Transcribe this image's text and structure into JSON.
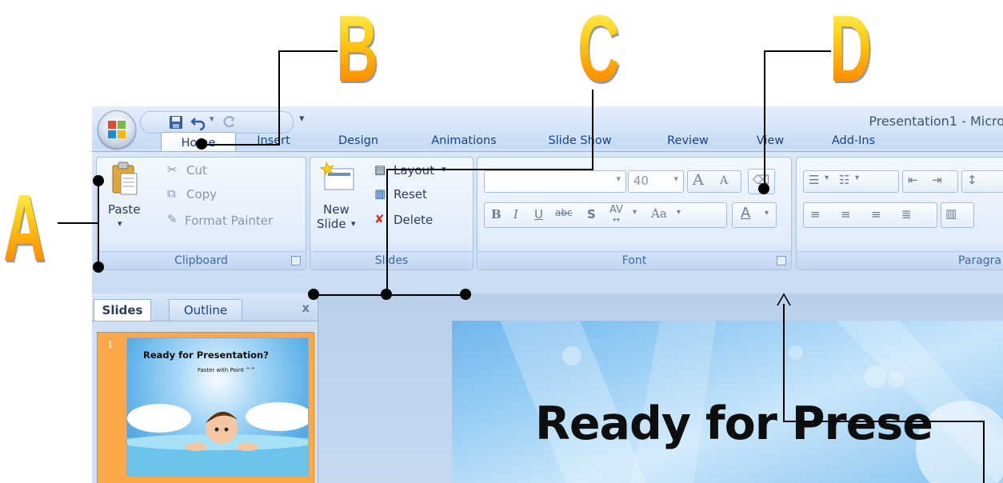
{
  "callouts": {
    "a": "A",
    "b": "B",
    "c": "C",
    "d": "D"
  },
  "window": {
    "title": "Presentation1 - Micro"
  },
  "tabs": [
    {
      "label": "Home"
    },
    {
      "label": "Insert"
    },
    {
      "label": "Design"
    },
    {
      "label": "Animations"
    },
    {
      "label": "Slide Show"
    },
    {
      "label": "Review"
    },
    {
      "label": "View"
    },
    {
      "label": "Add-Ins"
    }
  ],
  "clipboard": {
    "paste": "Paste",
    "cut": "Cut",
    "copy": "Copy",
    "format_painter": "Format Painter",
    "label": "Clipboard"
  },
  "slides_group": {
    "new_slide_line1": "New",
    "new_slide_line2": "Slide",
    "layout": "Layout",
    "reset": "Reset",
    "delete": "Delete",
    "label": "Slides"
  },
  "font_group": {
    "font_name": "",
    "font_size": "40",
    "grow": "A",
    "shrink": "A",
    "bold": "B",
    "italic": "I",
    "underline": "U",
    "strike": "abc",
    "shadow": "S",
    "spacing": "AV",
    "change_case": "Aa",
    "font_color": "A",
    "label": "Font"
  },
  "paragraph_group": {
    "label": "Paragra"
  },
  "pane": {
    "slides_tab": "Slides",
    "outline_tab": "Outline",
    "close": "x",
    "slide_number": "1",
    "thumb_title": "Ready for Presentation?",
    "thumb_subtitle": "Faster with Point ^^"
  },
  "slide": {
    "title": "Ready for Prese"
  },
  "colors": {
    "ribbon": "#dbe8f8",
    "tab_text": "#15428b",
    "callout_gold": "#ffc21a",
    "thumb_frame": "#fba84a"
  }
}
